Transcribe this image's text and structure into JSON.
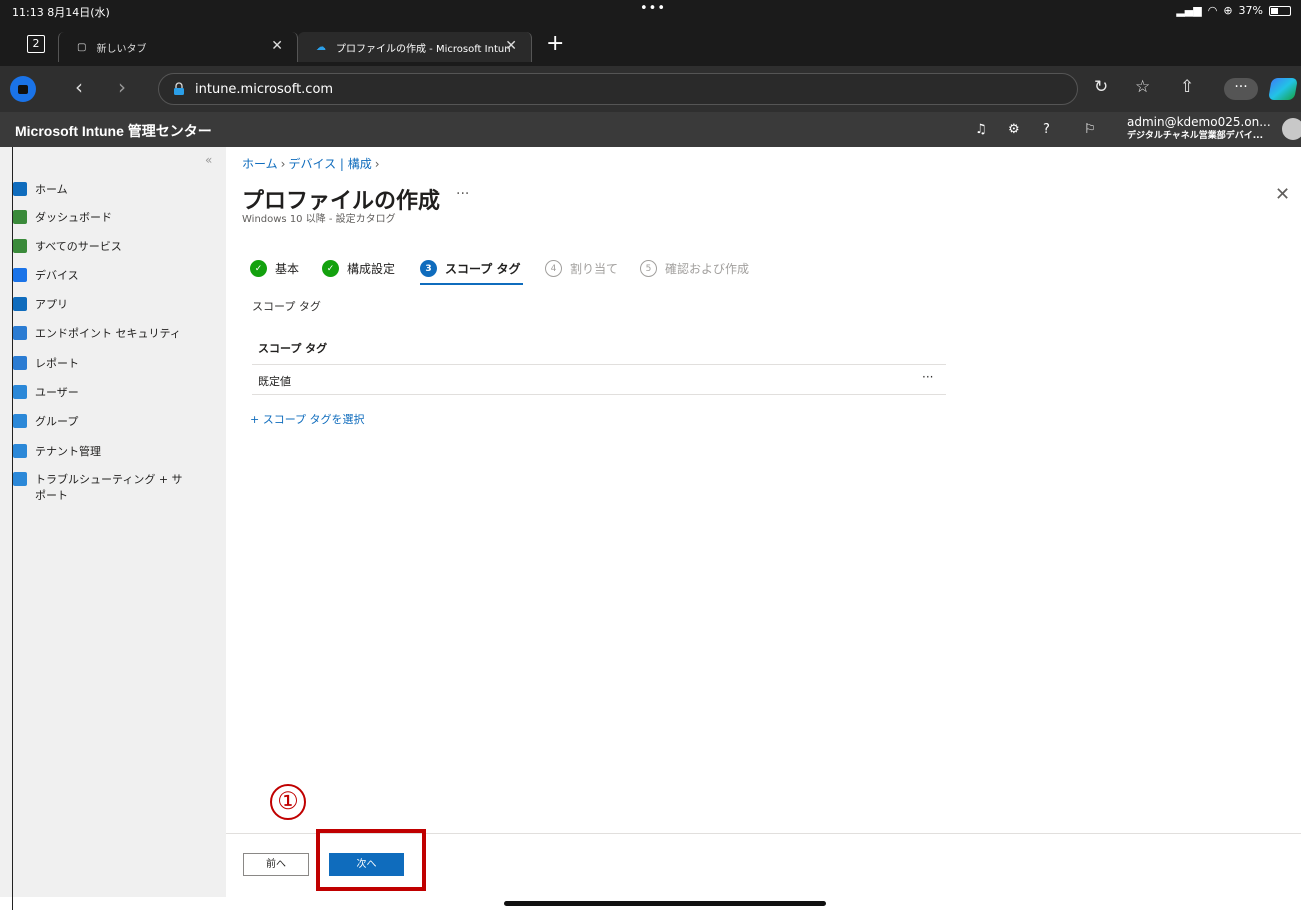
{
  "status": {
    "time": "11:13  8月14日(水)",
    "dots": "•••",
    "battery": "37%",
    "battery_level": 0.37
  },
  "browser": {
    "tab_count": "2",
    "tabs": [
      {
        "title": "新しいタブ"
      },
      {
        "title": "プロファイルの作成 - Microsoft Intun"
      }
    ],
    "url": "intune.microsoft.com"
  },
  "app": {
    "title": "Microsoft Intune 管理センター",
    "account_email": "admin@kdemo025.on...",
    "account_org": "デジタルチャネル営業部デバイ..."
  },
  "sidebar": {
    "items": [
      {
        "label": "ホーム",
        "color": "#0f6cbd"
      },
      {
        "label": "ダッシュボード",
        "color": "#3a8a3a"
      },
      {
        "label": "すべてのサービス",
        "color": "#3a8a3a"
      },
      {
        "label": "デバイス",
        "color": "#1a73e8"
      },
      {
        "label": "アプリ",
        "color": "#0f6cbd"
      },
      {
        "label": "エンドポイント セキュリティ",
        "color": "#2b7cd3"
      },
      {
        "label": "レポート",
        "color": "#2b7cd3"
      },
      {
        "label": "ユーザー",
        "color": "#2b88d8"
      },
      {
        "label": "グループ",
        "color": "#2b88d8"
      },
      {
        "label": "テナント管理",
        "color": "#2b88d8"
      },
      {
        "label": "トラブルシューティング + サ",
        "label2": "ポート",
        "color": "#2b88d8"
      }
    ]
  },
  "breadcrumb": {
    "home": "ホーム",
    "device": "デバイス | 構成"
  },
  "page": {
    "title": "プロファイルの作成",
    "more": "···",
    "subtitle": "Windows 10 以降 - 設定カタログ"
  },
  "wizard": {
    "steps": [
      {
        "num": "✓",
        "label": "基本",
        "state": "done"
      },
      {
        "num": "✓",
        "label": "構成設定",
        "state": "done"
      },
      {
        "num": "3",
        "label": "スコープ タグ",
        "state": "current"
      },
      {
        "num": "4",
        "label": "割り当て",
        "state": "todo"
      },
      {
        "num": "5",
        "label": "確認および作成",
        "state": "todo"
      }
    ]
  },
  "scope": {
    "section_label": "スコープ タグ",
    "column_header": "スコープ タグ",
    "rows": [
      {
        "value": "既定値"
      }
    ],
    "row_more": "···",
    "add_link": "+ スコープ タグを選択"
  },
  "footer": {
    "prev_label": "前へ",
    "next_label": "次へ"
  },
  "annotation": {
    "marker": "①",
    "color": "#c00000"
  }
}
